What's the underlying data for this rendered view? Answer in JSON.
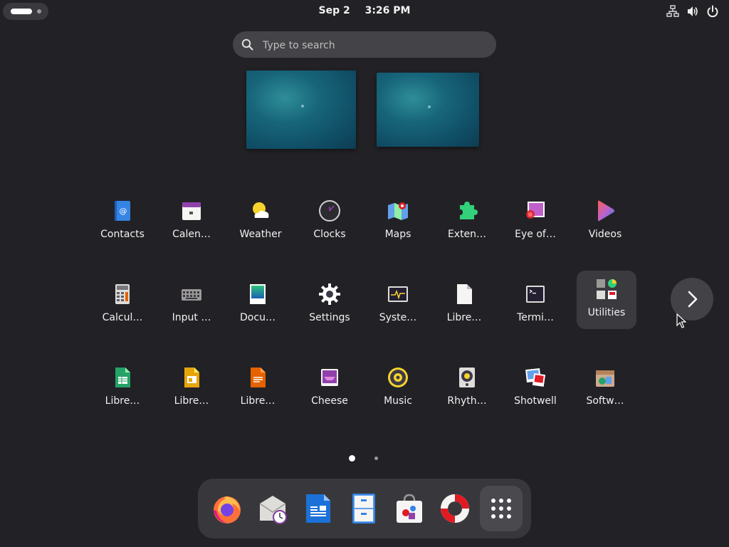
{
  "topbar": {
    "date": "Sep 2",
    "time": "3:26 PM",
    "tray_icons": [
      "accessibility-network-icon",
      "volume-icon",
      "power-icon"
    ]
  },
  "search": {
    "placeholder": "Type to search"
  },
  "apps": {
    "row1": [
      "Contacts",
      "Calen…",
      "Weather",
      "Clocks",
      "Maps",
      "Exten…",
      "Eye of…",
      "Videos"
    ],
    "row2": [
      "Calcul…",
      "Input …",
      "Docu…",
      "Settings",
      "Syste…",
      "Libre…",
      "Termi…",
      "Utilities"
    ],
    "row3": [
      "Libre…",
      "Libre…",
      "Libre…",
      "Cheese",
      "Music",
      "Rhyth…",
      "Shotwell",
      "Softw…"
    ]
  },
  "pagination": {
    "pages": 2,
    "current": 1
  },
  "dock": [
    "firefox",
    "evolution",
    "writer",
    "files",
    "software",
    "help",
    "show-apps"
  ]
}
